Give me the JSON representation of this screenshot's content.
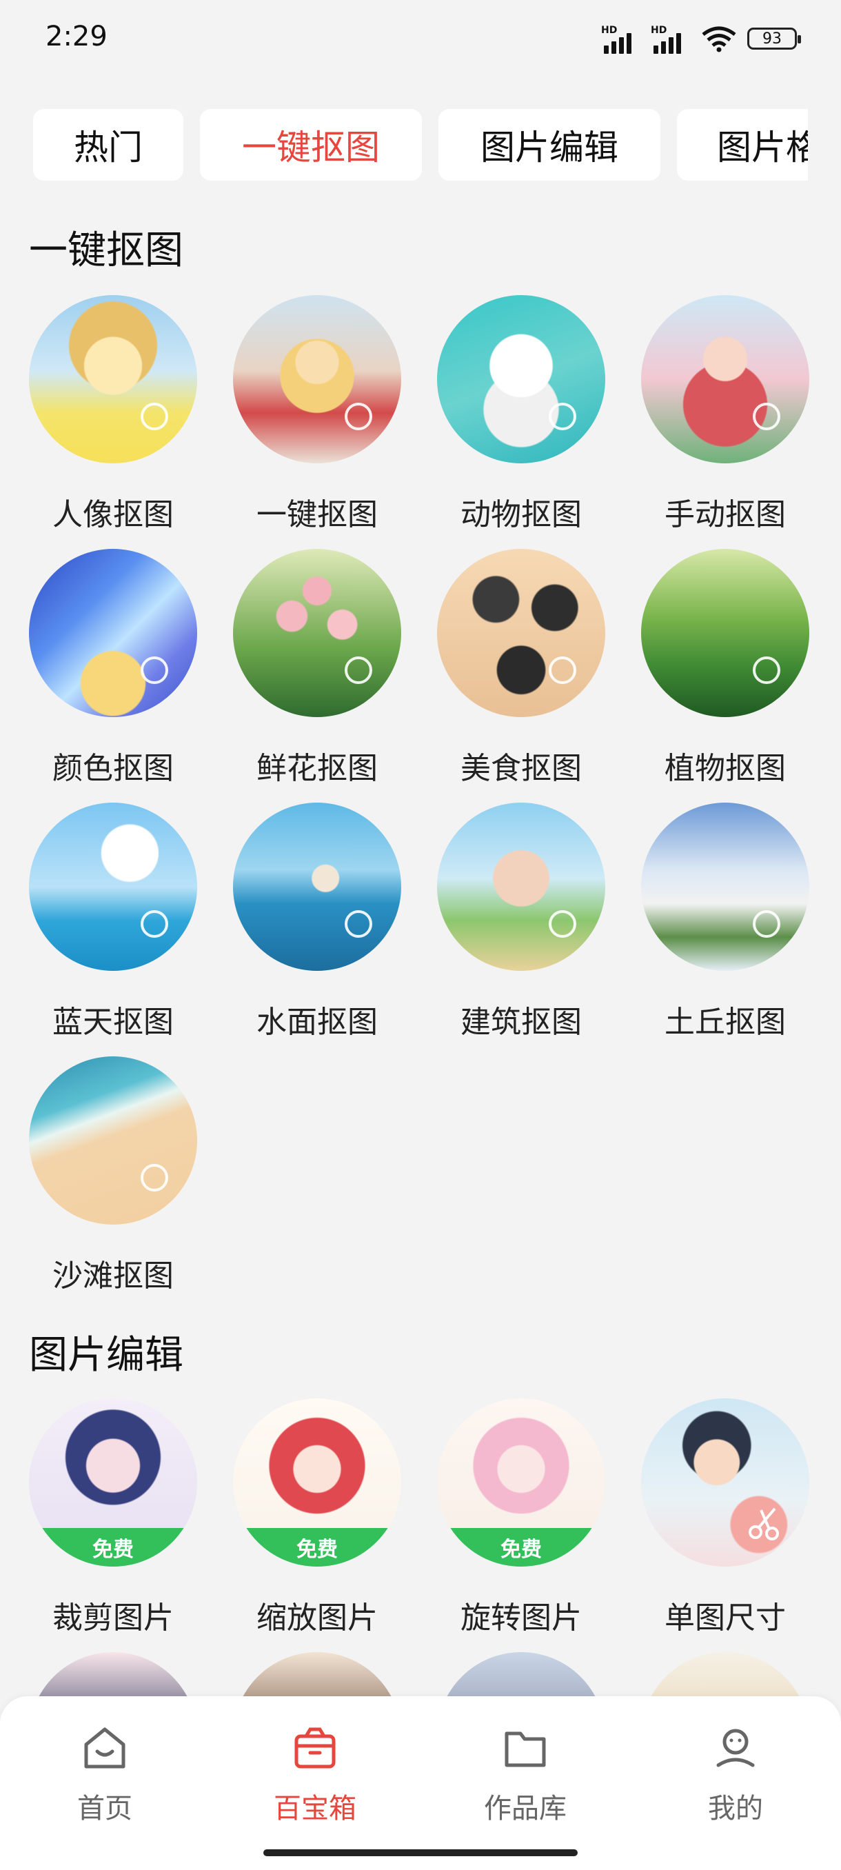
{
  "status_bar": {
    "time": "2:29",
    "battery": "93",
    "hd1": "HD",
    "hd2": "HD"
  },
  "tabs": [
    {
      "label": "热门"
    },
    {
      "label": "一键抠图"
    },
    {
      "label": "图片编辑"
    },
    {
      "label": "图片格"
    }
  ],
  "sections": {
    "cutout": {
      "title": "一键抠图",
      "items": [
        {
          "label": "人像抠图"
        },
        {
          "label": "一键抠图"
        },
        {
          "label": "动物抠图"
        },
        {
          "label": "手动抠图"
        },
        {
          "label": "颜色抠图"
        },
        {
          "label": "鲜花抠图"
        },
        {
          "label": "美食抠图"
        },
        {
          "label": "植物抠图"
        },
        {
          "label": "蓝天抠图"
        },
        {
          "label": "水面抠图"
        },
        {
          "label": "建筑抠图"
        },
        {
          "label": "土丘抠图"
        },
        {
          "label": "沙滩抠图"
        }
      ]
    },
    "edit": {
      "title": "图片编辑",
      "items": [
        {
          "label": "裁剪图片",
          "badge": "免费"
        },
        {
          "label": "缩放图片",
          "badge": "免费"
        },
        {
          "label": "旋转图片",
          "badge": "免费"
        },
        {
          "label": "单图尺寸"
        }
      ]
    }
  },
  "bottom_nav": [
    {
      "label": "首页",
      "icon": "home-icon"
    },
    {
      "label": "百宝箱",
      "icon": "toolbox-icon"
    },
    {
      "label": "作品库",
      "icon": "folder-icon"
    },
    {
      "label": "我的",
      "icon": "profile-icon"
    }
  ],
  "colors": {
    "accent": "#e5463d",
    "badge": "#33c05b",
    "background": "#f3f3f3"
  }
}
